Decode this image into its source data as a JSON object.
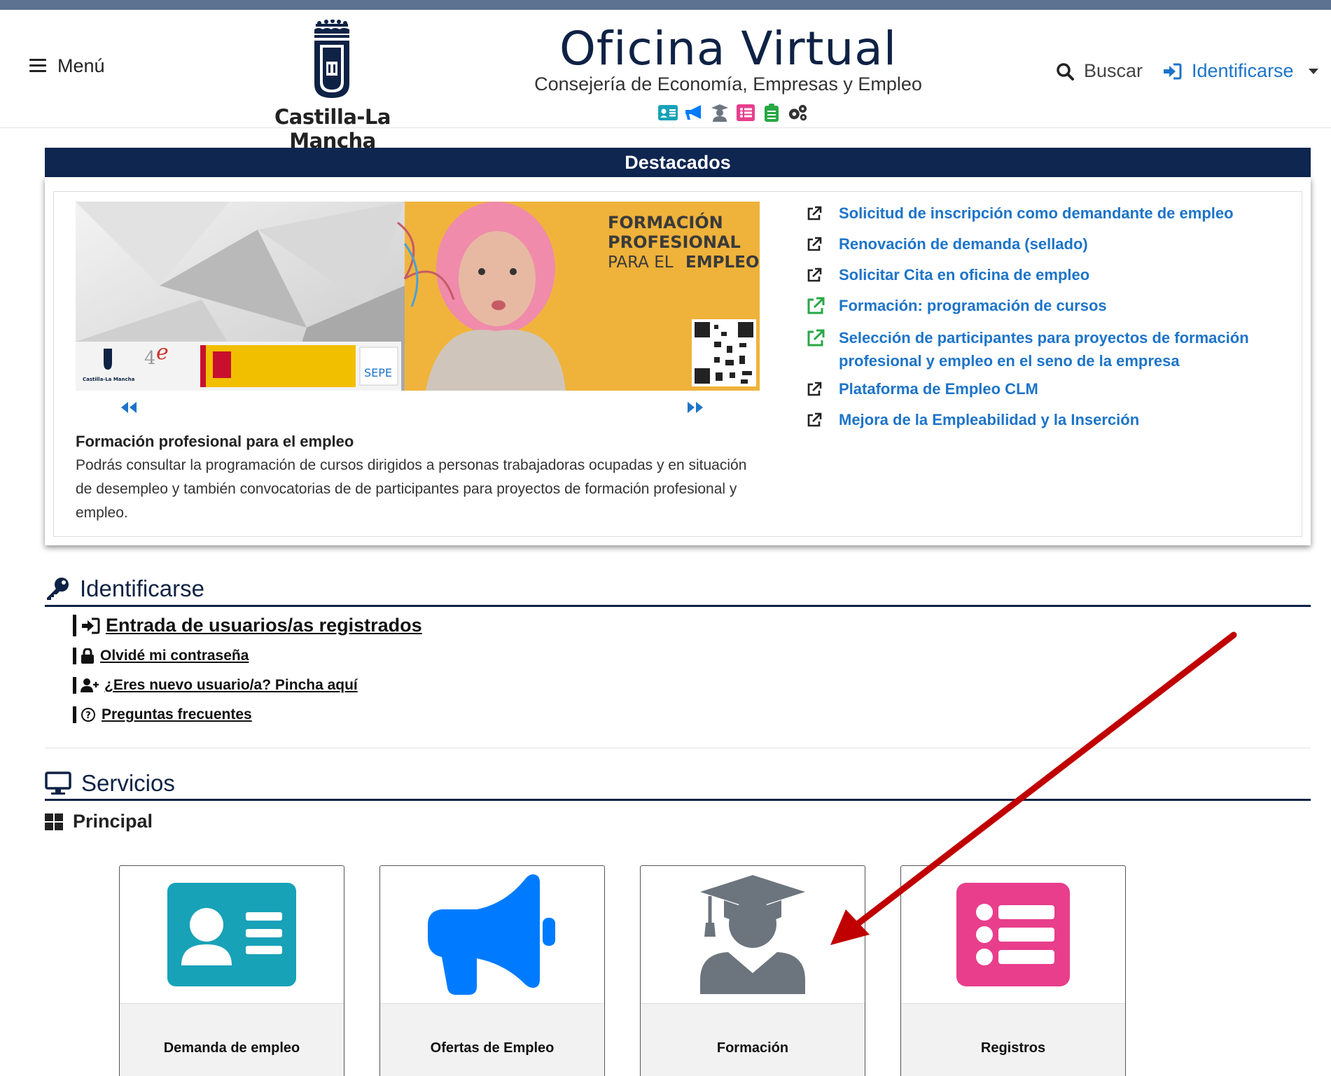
{
  "header": {
    "menu_label": "Menú",
    "logo_text": "Castilla-La Mancha",
    "title": "Oficina Virtual",
    "subtitle": "Consejería de Economía, Empresas y Empleo",
    "service_icons": [
      "id-card-icon",
      "megaphone-icon",
      "graduate-icon",
      "list-icon",
      "clipboard-icon",
      "gears-icon"
    ],
    "search_label": "Buscar",
    "identify_label": "Identificarse"
  },
  "destacados": {
    "title": "Destacados",
    "banner": {
      "line1": "FORMACIÓN",
      "line2": "PROFESIONAL",
      "line3a": "PARA EL ",
      "line3b": "EMPLEO",
      "logo_sepe": "SEPE",
      "logo_clm": "Castilla-La Mancha"
    },
    "item_title": "Formación profesional para el empleo",
    "item_text": "Podrás consultar la programación de cursos dirigidos a personas trabajadoras ocupadas y en situación de desempleo y también convocatorias de de participantes para proyectos de formación profesional y empleo.",
    "links": [
      {
        "label": "Solicitud de inscripción como demandante de empleo",
        "icon": "external-link-icon",
        "color": "#222222"
      },
      {
        "label": "Renovación de demanda (sellado)",
        "icon": "external-link-icon",
        "color": "#222222"
      },
      {
        "label": "Solicitar Cita en oficina de empleo",
        "icon": "external-link-icon",
        "color": "#222222"
      },
      {
        "label": "Formación: programación de cursos",
        "icon": "external-link-icon",
        "color": "#28a745"
      },
      {
        "label": "Selección de participantes para proyectos de formación profesional y empleo en el seno de la empresa",
        "icon": "external-link-icon",
        "color": "#28a745"
      },
      {
        "label": "Plataforma de Empleo CLM",
        "icon": "external-link-icon",
        "color": "#222222"
      },
      {
        "label": "Mejora de la Empleabilidad y la Inserción",
        "icon": "external-link-icon",
        "color": "#222222"
      }
    ]
  },
  "identificarse": {
    "title": "Identificarse",
    "links": [
      {
        "label": "Entrada de usuarios/as registrados",
        "icon": "sign-in-icon"
      },
      {
        "label": "Olvidé mi contraseña",
        "icon": "lock-icon"
      },
      {
        "label": "¿Eres nuevo usuario/a? Pincha aquí",
        "icon": "user-plus-icon"
      },
      {
        "label": "Preguntas frecuentes",
        "icon": "question-circle-icon"
      }
    ]
  },
  "servicios": {
    "title": "Servicios",
    "principal_label": "Principal",
    "cards": [
      {
        "label": "Demanda de empleo",
        "icon": "id-card-icon",
        "color": "#17a2b8"
      },
      {
        "label": "Ofertas de Empleo",
        "icon": "megaphone-icon",
        "color": "#007bff"
      },
      {
        "label": "Formación",
        "icon": "graduate-icon",
        "color": "#6c757d"
      },
      {
        "label": "Registros",
        "icon": "list-icon",
        "color": "#e83e8c"
      }
    ]
  },
  "annotation": {
    "color": "#c00000"
  }
}
